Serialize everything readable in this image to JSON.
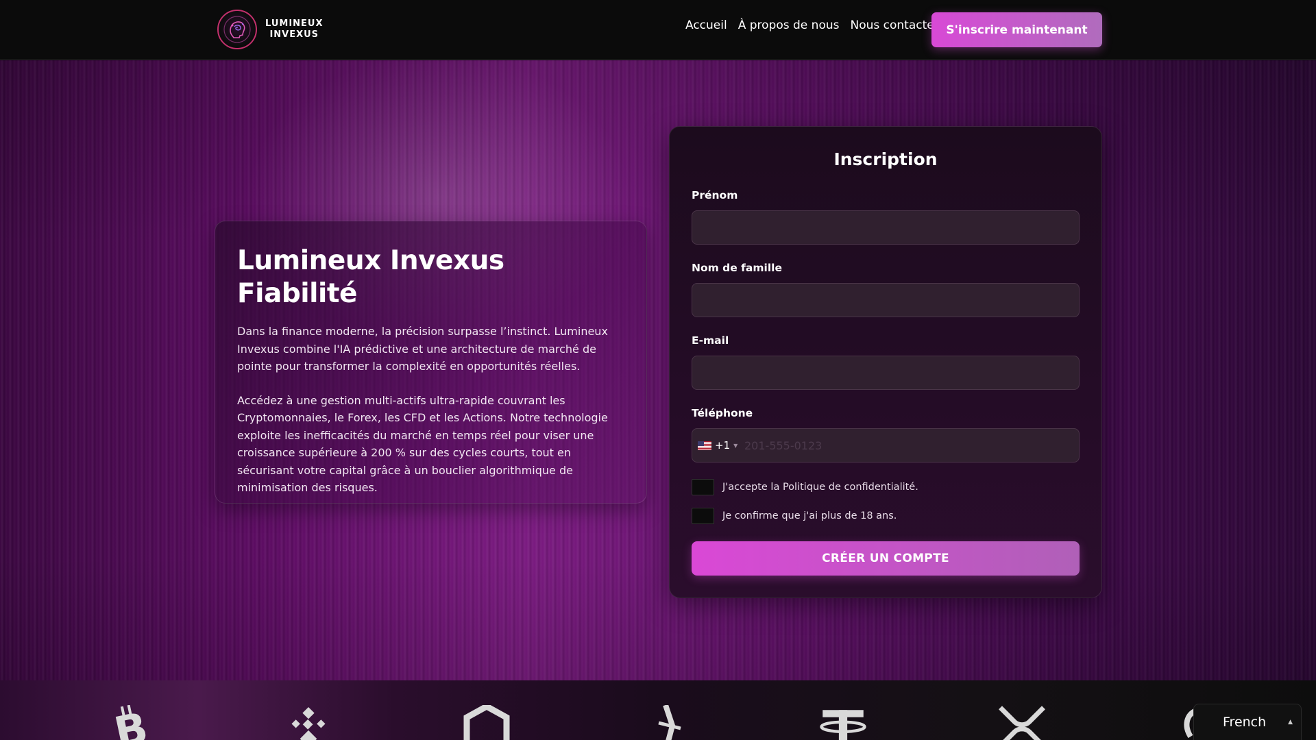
{
  "brand": {
    "line1": "LUMINEUX",
    "line2": "INVEXUS",
    "accent_color": "#d849d6"
  },
  "nav": {
    "items": [
      {
        "label": "Accueil"
      },
      {
        "label": "À propos de nous"
      },
      {
        "label": "Nous contacter"
      }
    ],
    "cta_label": "S'inscrire maintenant"
  },
  "hero": {
    "title": "Lumineux Invexus Fiabilité",
    "paragraph1": "Dans la finance moderne, la précision surpasse l’instinct. Lumineux Invexus combine l'IA prédictive et une architecture de marché de pointe pour transformer la complexité en opportunités réelles.",
    "paragraph2": "Accédez à une gestion multi-actifs ultra-rapide couvrant les Cryptomonnaies, le Forex, les CFD et les Actions. Notre technologie exploite les inefficacités du marché en temps réel pour viser une croissance supérieure à 200 % sur des cycles courts, tout en sécurisant votre capital grâce à un bouclier algorithmique de minimisation des risques."
  },
  "form": {
    "title": "Inscription",
    "first_name_label": "Prénom",
    "first_name_value": "",
    "last_name_label": "Nom de famille",
    "last_name_value": "",
    "email_label": "E-mail",
    "email_value": "",
    "phone_label": "Téléphone",
    "phone_code": "+1",
    "phone_placeholder": "201-555-0123",
    "privacy_label": "J'accepte la Politique de confidentialité.",
    "age_label": "Je confirme que j'ai plus de 18 ans.",
    "submit_label": "CRÉER UN COMPTE"
  },
  "crypto_icons": [
    "bitcoin-icon",
    "binance-icon",
    "chainlink-icon",
    "stellar-icon",
    "tether-icon",
    "xrp-icon",
    "ethereum-icon"
  ],
  "language": {
    "label": "French"
  }
}
